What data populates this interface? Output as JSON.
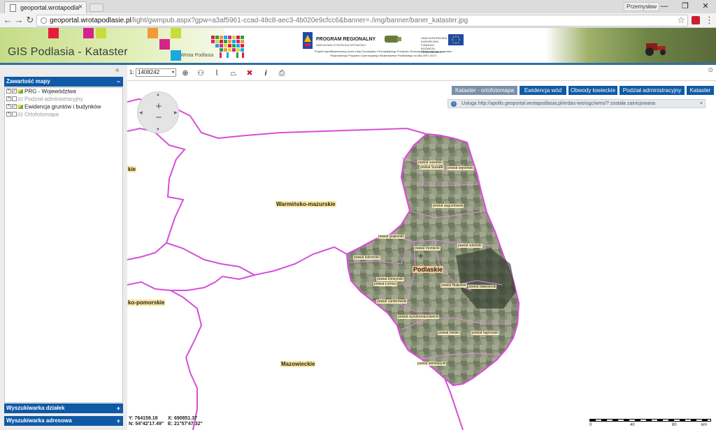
{
  "browser": {
    "tab_title": "geoportal.wrotapodlasie",
    "tab_close": "×",
    "profile_name": "Przemysław",
    "window_controls": {
      "minimize": "—",
      "restore": "❐",
      "close": "✕"
    },
    "nav": {
      "back": "←",
      "forward": "→",
      "reload": "↻",
      "menu": "⋮",
      "star": "☆"
    },
    "url_host": "geoportal.wrotapodlasie.pl",
    "url_rest": "/light/gwmpub.aspx?gpw=a3af5961-ccad-48c8-aec3-4b020e9cfcc6&banner=./img/banner/baner_kataster.jpg"
  },
  "banner": {
    "app_title": "GIS Podlasia - Kataster",
    "wrota_label": "Wrota Podlasia",
    "program_label": "PROGRAM REGIONALNY",
    "program_sub": "NARODOWA STRATEGIA SPÓJNOŚCI",
    "eu_text": "UNIA EUROPEJSKA EUROPEJSKI FUNDUSZ ROZWOJU REGIONALNEGO",
    "caption": "Projekt współfinansowany przez Unię Europejską z Europejskiego Funduszu Rozwoju Regionalnego w ramach Regionalnego Programu Operacyjnego Województwa Podlaskiego na lata 2007-2013",
    "colors": {
      "banner_green": "#c5dc87",
      "accent_blue": "#0f5aa6",
      "magenta": "#d6238a",
      "orange": "#f29a38",
      "yellow_green": "#c9dc3c",
      "red": "#e31d3c",
      "cyan": "#19a8e0"
    }
  },
  "left_panel": {
    "collapse_icon": "«",
    "contents_title": "Zawartość mapy",
    "contents_sign": "−",
    "layers": [
      {
        "label": "PRG - Województwa",
        "checked": true,
        "enabled": true
      },
      {
        "label": "Podział administracyjny",
        "checked": false,
        "enabled": false
      },
      {
        "label": "Ewidencja gruntów i budynków",
        "checked": true,
        "enabled": true
      },
      {
        "label": "Ortofotomapa",
        "checked": false,
        "enabled": false
      }
    ],
    "search_parcels": "Wyszukiwarka działek",
    "search_address": "Wyszukiwarka adresowa",
    "plus_sign": "+"
  },
  "toolbar": {
    "scale_prefix": "1:",
    "scale_value": "1408242",
    "scale_arrow": "▾",
    "tools": [
      "zoom-tool-icon",
      "user-tool-icon",
      "measure-line-icon",
      "measure-area-icon",
      "clear-tool-icon",
      "info-tool-icon",
      "print-tool-icon"
    ],
    "tool_glyphs": {
      "zoom": "⊕",
      "user": "⚇",
      "line": "⌇",
      "area": "⏢",
      "clear": "✖",
      "info": "i",
      "print": "⎙"
    },
    "collapse_icon": "⊙"
  },
  "map": {
    "tabs": [
      "Kataster - ortofotomapa",
      "Ewidencja wód",
      "Obwody łowieckie",
      "Podział administracyjny",
      "Kataster"
    ],
    "active_tab": 0,
    "notice": "Usługa http://apollo.geoportal.wrotapodlasia.pl/erdas-iws/ogc/wms/? została zainicjowana",
    "notice_close": "×",
    "notice_info": "i",
    "zoom_in": "+",
    "zoom_out": "−",
    "zoom_arrows": {
      "up": "▲",
      "down": "▼",
      "left": "◀",
      "right": "▶"
    },
    "regions": {
      "warm": "Warmińsko-mazurskie",
      "maz": "Mazowieckie",
      "kpom": "ko-pomorskie",
      "edge": "kie",
      "podl": "Podlaskie"
    },
    "powiaty": {
      "suwalski": "powiat suwalski",
      "suwalki": "powiat Suwałki",
      "sejnenski": "powiat sejneński",
      "augustowski": "powiat augustowski",
      "grajewski": "powiat grajewski",
      "monki": "powiat moniecki",
      "sokolski": "powiat sokólski",
      "kolnenski": "powiat kolneński",
      "bialystok_city": "powiat Białystok",
      "bialostocki": "powiat białostocki",
      "lomzynski": "powiat łomżyński",
      "lomza": "powiat Łomża",
      "zambrowski": "powiat zambrowski",
      "wysokomaz": "powiat wysokomazowiecki",
      "bielski": "powiat bielski",
      "hajnowski": "powiat hajnowski",
      "siemiatycki": "powiat siemiatycki"
    },
    "coords": {
      "y": "Y: 764159.18",
      "n": "N: 54°42'17.49\"",
      "x": "X: 690851.37",
      "e": "E: 21°57'47.32\""
    },
    "scalebar": {
      "labels": [
        "0",
        "40",
        "80",
        "km"
      ]
    },
    "cursor": "✛"
  }
}
